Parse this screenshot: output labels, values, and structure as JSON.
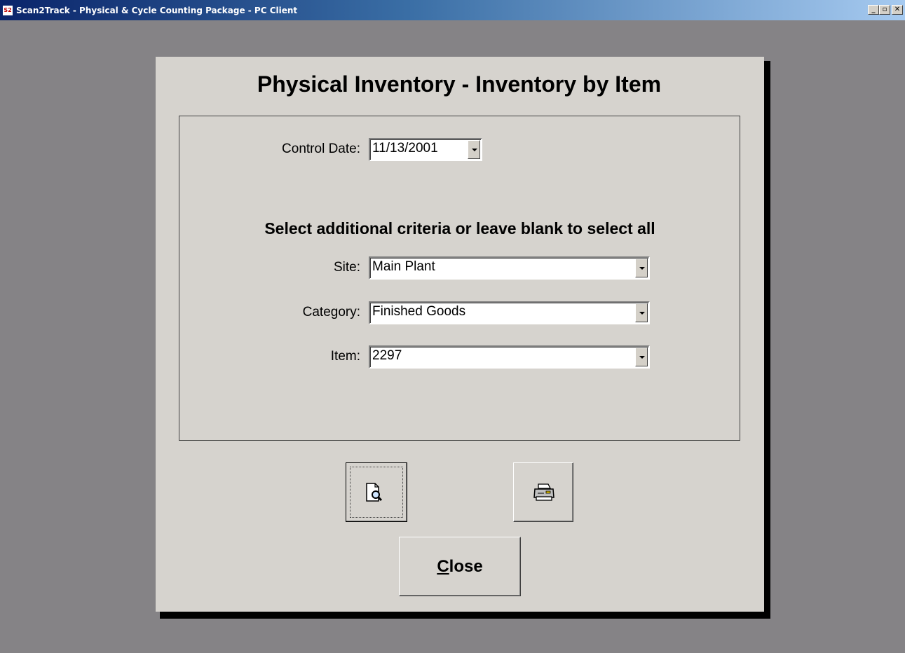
{
  "window": {
    "title": "Scan2Track - Physical & Cycle Counting Package - PC Client",
    "app_icon_text": "S2",
    "minimize_glyph": "_",
    "maximize_glyph": "▫",
    "close_glyph": "✕"
  },
  "dialog": {
    "title": "Physical Inventory - Inventory by Item",
    "control_date": {
      "label": "Control Date:",
      "value": "11/13/2001"
    },
    "criteria_heading": "Select additional criteria or leave blank to select all",
    "site": {
      "label": "Site:",
      "value": "Main Plant"
    },
    "category": {
      "label": "Category:",
      "value": "Finished Goods"
    },
    "item": {
      "label": "Item:",
      "value": "2297"
    },
    "buttons": {
      "preview_icon": "print-preview-icon",
      "print_icon": "printer-icon",
      "close_mnemonic": "C",
      "close_rest": "lose"
    }
  }
}
